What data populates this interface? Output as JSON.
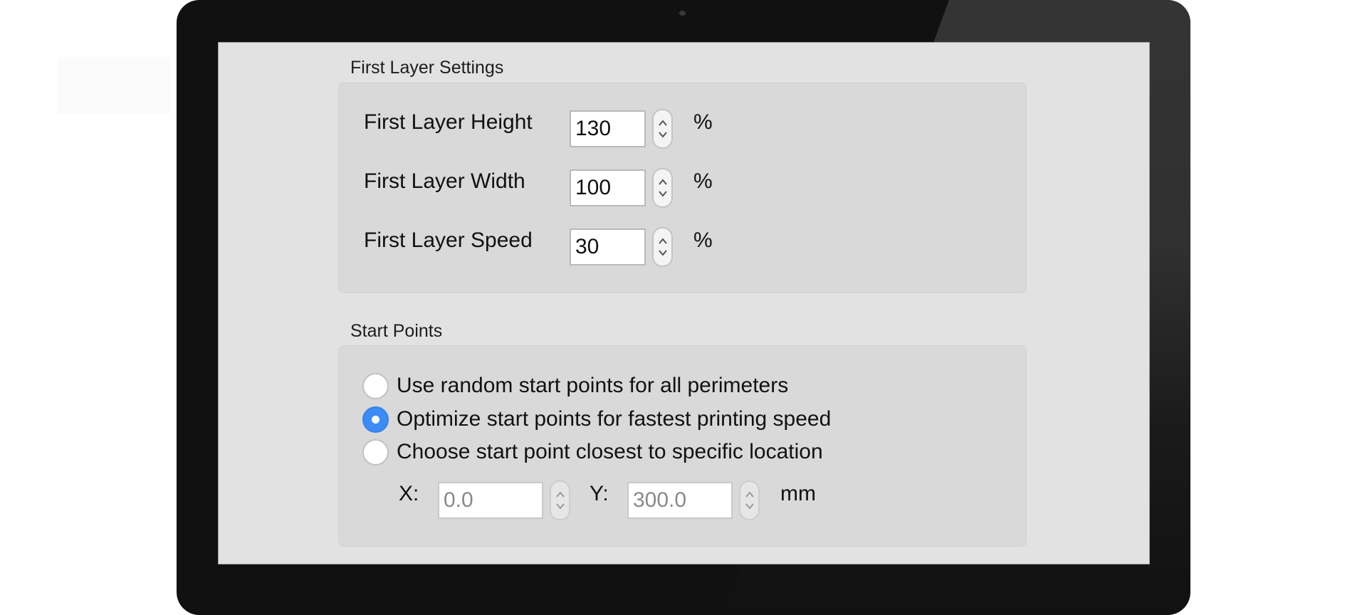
{
  "first_layer": {
    "title": "First Layer Settings",
    "rows": [
      {
        "label": "First Layer Height",
        "value": "130",
        "unit": "%"
      },
      {
        "label": "First Layer Width",
        "value": "100",
        "unit": "%"
      },
      {
        "label": "First Layer Speed",
        "value": "30",
        "unit": "%"
      }
    ]
  },
  "start_points": {
    "title": "Start Points",
    "options": [
      {
        "label": "Use random start points for all perimeters",
        "checked": false
      },
      {
        "label": "Optimize start points for fastest printing speed",
        "checked": true
      },
      {
        "label": "Choose start point closest to specific location",
        "checked": false
      }
    ],
    "location": {
      "x_label": "X:",
      "x_value": "0.0",
      "y_label": "Y:",
      "y_value": "300.0",
      "unit": "mm",
      "enabled": false
    }
  },
  "colors": {
    "accent": "#3d8cf5",
    "screen_bg": "#e2e2e2",
    "group_bg": "#d9d9d9",
    "bezel": "#111111"
  },
  "icons": {
    "stepper": "up-down-chevrons",
    "camera": "webcam-dot"
  }
}
